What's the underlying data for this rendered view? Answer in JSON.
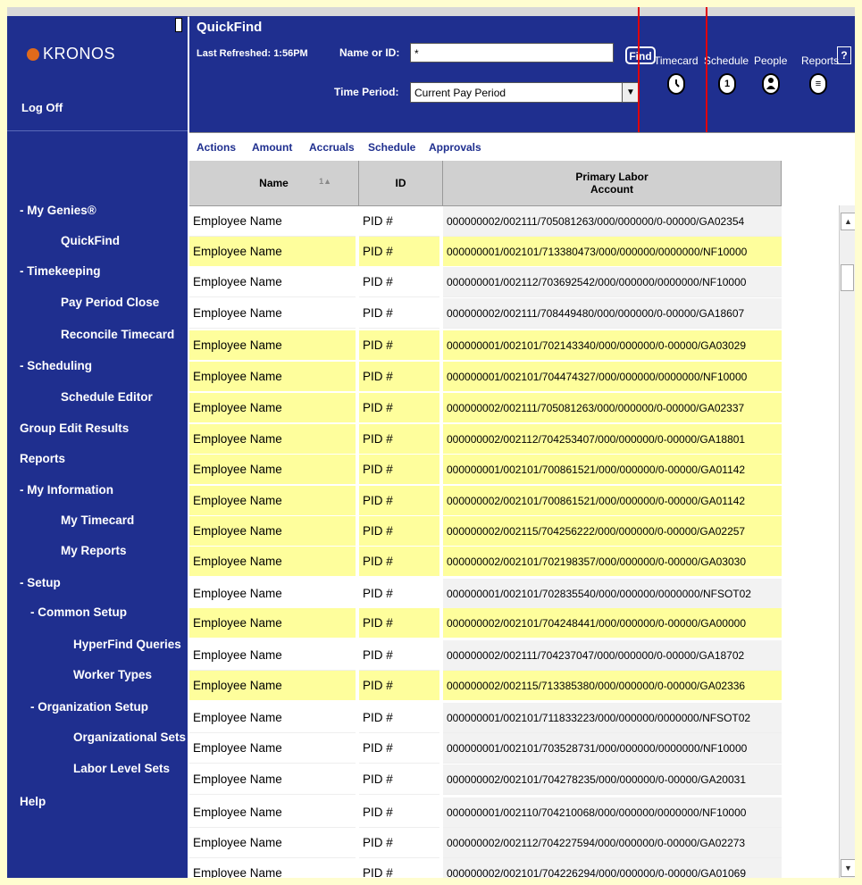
{
  "brand": {
    "name": "KRONOS",
    "logoff": "Log Off"
  },
  "nav": [
    {
      "label": "- My Genies®",
      "indent": 0
    },
    {
      "label": "QuickFind",
      "indent": 1
    },
    {
      "label": "- Timekeeping",
      "indent": 0
    },
    {
      "label": "Pay Period Close",
      "indent": 1
    },
    {
      "label": "Reconcile Timecard",
      "indent": 1
    },
    {
      "label": "- Scheduling",
      "indent": 0
    },
    {
      "label": "Schedule Editor",
      "indent": 1
    },
    {
      "label": "Group Edit Results",
      "indent": 0
    },
    {
      "label": "Reports",
      "indent": 0
    },
    {
      "label": "- My Information",
      "indent": 0
    },
    {
      "label": "My Timecard",
      "indent": 1
    },
    {
      "label": "My Reports",
      "indent": 1
    },
    {
      "label": "- Setup",
      "indent": 0
    },
    {
      "label": "- Common Setup",
      "indent": 1
    },
    {
      "label": "HyperFind Queries",
      "indent": 2
    },
    {
      "label": "Worker Types",
      "indent": 2
    },
    {
      "label": "- Organization Setup",
      "indent": 1
    },
    {
      "label": "Organizational Sets",
      "indent": 2
    },
    {
      "label": "Labor Level Sets",
      "indent": 2
    },
    {
      "label": "Help",
      "indent": 0
    }
  ],
  "header": {
    "title": "QuickFind",
    "refreshed": "Last Refreshed: 1:56PM",
    "name_label": "Name or ID:",
    "name_value": "*",
    "find_label": "Find",
    "period_label": "Time Period:",
    "period_value": "Current Pay Period",
    "help": "?",
    "widgets": [
      {
        "label": "Timecard",
        "icon": "clock-icon",
        "glyph": ""
      },
      {
        "label": "Schedule",
        "icon": "calendar-icon",
        "glyph": "1"
      },
      {
        "label": "People",
        "icon": "person-icon",
        "glyph": ""
      },
      {
        "label": "Reports",
        "icon": "report-icon",
        "glyph": "≡"
      }
    ]
  },
  "actions": [
    "Actions",
    "Amount",
    "Accruals",
    "Schedule",
    "Approvals"
  ],
  "table": {
    "columns": {
      "name": "Name",
      "id": "ID",
      "account_line1": "Primary Labor",
      "account_line2": "Account",
      "sort_indicator": "1▲"
    },
    "rows": [
      {
        "name": "Employee Name",
        "id": "PID #",
        "account": "000000002/002111/705081263/000/000000/0-00000/GA02354",
        "yellow": false
      },
      {
        "name": "Employee Name",
        "id": "PID #",
        "account": "000000001/002101/713380473/000/000000/0000000/NF10000",
        "yellow": true
      },
      {
        "name": "Employee Name",
        "id": "PID #",
        "account": "000000001/002112/703692542/000/000000/0000000/NF10000",
        "yellow": false
      },
      {
        "name": "Employee Name",
        "id": "PID #",
        "account": "000000002/002111/708449480/000/000000/0-00000/GA18607",
        "yellow": false
      },
      {
        "name": "Employee Name",
        "id": "PID #",
        "account": "000000001/002101/702143340/000/000000/0-00000/GA03029",
        "yellow": true
      },
      {
        "name": "Employee Name",
        "id": "PID #",
        "account": "000000001/002101/704474327/000/000000/0000000/NF10000",
        "yellow": true
      },
      {
        "name": "Employee Name",
        "id": "PID #",
        "account": "000000002/002111/705081263/000/000000/0-00000/GA02337",
        "yellow": true
      },
      {
        "name": "Employee Name",
        "id": "PID #",
        "account": "000000002/002112/704253407/000/000000/0-00000/GA18801",
        "yellow": true
      },
      {
        "name": "Employee Name",
        "id": "PID #",
        "account": "000000001/002101/700861521/000/000000/0-00000/GA01142",
        "yellow": true
      },
      {
        "name": "Employee Name",
        "id": "PID #",
        "account": "000000002/002101/700861521/000/000000/0-00000/GA01142",
        "yellow": true
      },
      {
        "name": "Employee Name",
        "id": "PID #",
        "account": "000000002/002115/704256222/000/000000/0-00000/GA02257",
        "yellow": true
      },
      {
        "name": "Employee Name",
        "id": "PID #",
        "account": "000000002/002101/702198357/000/000000/0-00000/GA03030",
        "yellow": true
      },
      {
        "name": "Employee Name",
        "id": "PID #",
        "account": "000000001/002101/702835540/000/000000/0000000/NFSOT02",
        "yellow": false
      },
      {
        "name": "Employee Name",
        "id": "PID #",
        "account": "000000002/002101/704248441/000/000000/0-00000/GA00000",
        "yellow": true
      },
      {
        "name": "Employee Name",
        "id": "PID #",
        "account": "000000002/002111/704237047/000/000000/0-00000/GA18702",
        "yellow": false
      },
      {
        "name": "Employee Name",
        "id": "PID #",
        "account": "000000002/002115/713385380/000/000000/0-00000/GA02336",
        "yellow": true
      },
      {
        "name": "Employee Name",
        "id": "PID #",
        "account": "000000001/002101/711833223/000/000000/0000000/NFSOT02",
        "yellow": false
      },
      {
        "name": "Employee Name",
        "id": "PID #",
        "account": "000000001/002101/703528731/000/000000/0000000/NF10000",
        "yellow": false
      },
      {
        "name": "Employee Name",
        "id": "PID #",
        "account": "000000002/002101/704278235/000/000000/0-00000/GA20031",
        "yellow": false
      },
      {
        "name": "Employee Name",
        "id": "PID #",
        "account": "000000001/002110/704210068/000/000000/0000000/NF10000",
        "yellow": false
      },
      {
        "name": "Employee Name",
        "id": "PID #",
        "account": "000000002/002112/704227594/000/000000/0-00000/GA02273",
        "yellow": false
      },
      {
        "name": "Employee Name",
        "id": "PID #",
        "account": "000000002/002101/704226294/000/000000/0-00000/GA01069",
        "yellow": false
      }
    ]
  },
  "colors": {
    "navy": "#1f2f8f",
    "highlight_row": "#fefe9c",
    "callout": "#e00000",
    "page_border": "#fffdd0"
  }
}
